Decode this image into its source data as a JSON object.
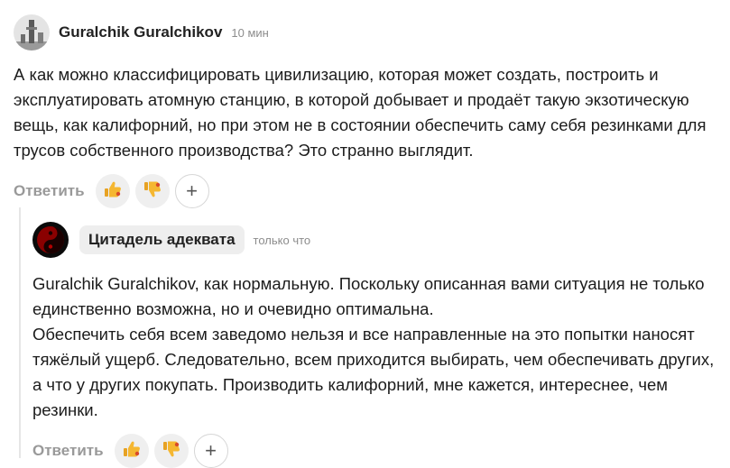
{
  "comment1": {
    "author": "Guralchik Guralchikov",
    "time": "10 мин",
    "text": "А как можно классифицировать цивилизацию, которая может создать, построить и эксплуатировать атомную станцию, в которой добывает и продаёт такую экзотическую вещь, как калифорний, но при этом не в состоянии обеспечить саму себя резинками для трусов собственного производства? Это странно выглядит.",
    "reply_label": "Ответить",
    "like_icon": "thumbs-up-icon",
    "dislike_icon": "thumbs-down-icon",
    "add_reaction": "+"
  },
  "comment2": {
    "author": "Цитадель адеквата",
    "time": "только что",
    "text_line1": "Guralchik Guralchikov, как нормальную. Поскольку описанная вами ситуация не только единственно возможна, но и очевидно оптимальна.",
    "text_line2": "Обеспечить себя всем заведомо нельзя и все направленные на это попытки наносят тяжёлый ущерб. Следовательно, всем приходится выбирать, чем обеспечивать других, а что у других покупать. Производить калифорний, мне кажется, интереснее, чем резинки.",
    "reply_label": "Ответить",
    "like_icon": "thumbs-up-icon",
    "dislike_icon": "thumbs-down-icon",
    "add_reaction": "+"
  },
  "colors": {
    "author_chip_bg": "#eeeeee",
    "muted_text": "#999999",
    "reaction_bg": "#efefef",
    "thumb_yellow": "#f5b731",
    "dislike_accent": "#d84a2a"
  }
}
